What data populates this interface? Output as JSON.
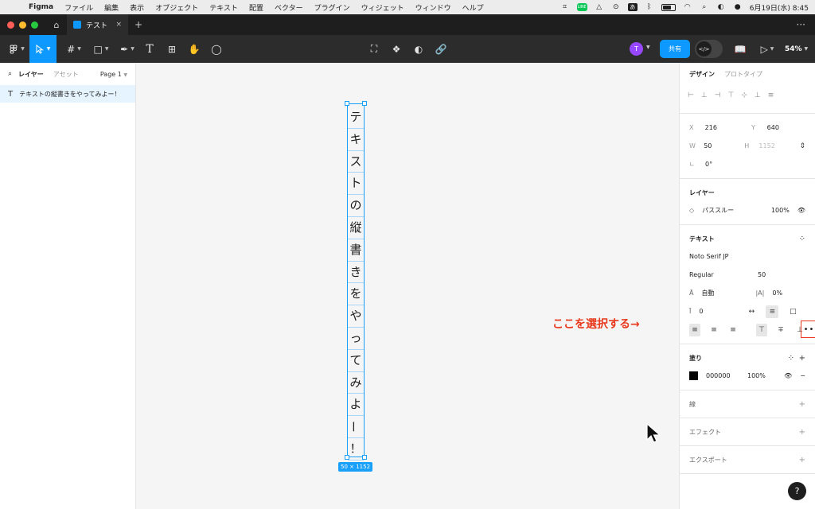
{
  "menubar": {
    "app": "Figma",
    "items": [
      "ファイル",
      "編集",
      "表示",
      "オブジェクト",
      "テキスト",
      "配置",
      "ベクター",
      "プラグイン",
      "ウィジェット",
      "ウィンドウ",
      "ヘルプ"
    ],
    "ime_char": "あ",
    "clock": "6月19日(水)  8:45"
  },
  "tabbar": {
    "file_tab": "テスト",
    "close_glyph": "×",
    "new_tab_glyph": "+",
    "more_glyph": "···"
  },
  "toolbar": {
    "share_label": "共有",
    "avatar_initial": "T",
    "zoom": "54%"
  },
  "left_panel": {
    "tab_layers": "レイヤー",
    "tab_assets": "アセット",
    "page_selector": "Page 1",
    "layer_name": "テキストの縦書きをやってみよー！"
  },
  "canvas": {
    "vertical_text": [
      "テ",
      "キ",
      "ス",
      "ト",
      "の",
      "縦",
      "書",
      "き",
      "を",
      "や",
      "っ",
      "て",
      "み",
      "よ",
      "ー",
      "！"
    ],
    "size_badge": "50 × 1152",
    "annotation": "ここを選択する→"
  },
  "right_panel": {
    "tab_design": "デザイン",
    "tab_prototype": "プロトタイプ",
    "position": {
      "x_label": "X",
      "x": "216",
      "y_label": "Y",
      "y": "640",
      "w_label": "W",
      "w": "50",
      "h_label": "H",
      "h": "1152",
      "rotation": "0°"
    },
    "layer": {
      "title": "レイヤー",
      "blend": "パススルー",
      "opacity": "100%"
    },
    "text": {
      "title": "テキスト",
      "font_family": "Noto Serif JP",
      "font_style": "Regular",
      "font_size": "50",
      "line_height": "自動",
      "letter_spacing": "0%",
      "paragraph_spacing": "0"
    },
    "fill": {
      "title": "塗り",
      "color": "000000",
      "opacity": "100%"
    },
    "stroke_title": "線",
    "effects_title": "エフェクト",
    "export_title": "エクスポート",
    "help": "?"
  },
  "colors": {
    "accent": "#0d99ff",
    "annotation": "#e8391d",
    "fill_swatch": "#000000"
  }
}
